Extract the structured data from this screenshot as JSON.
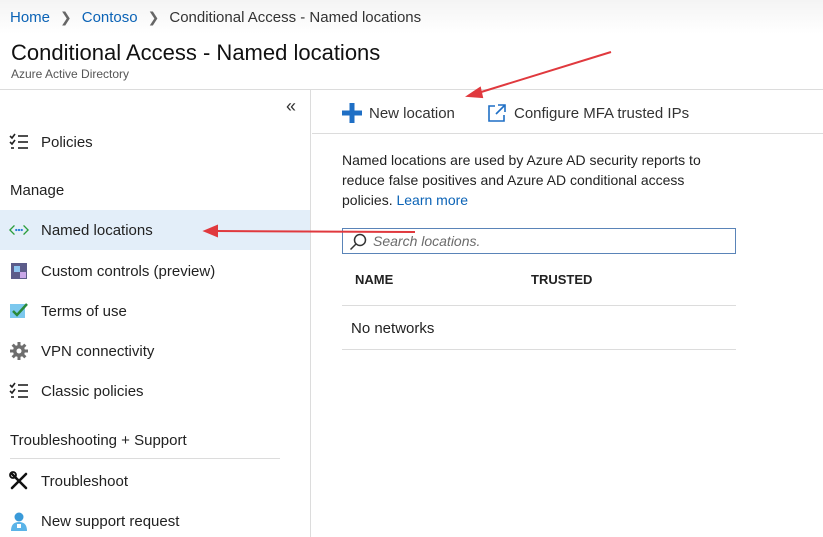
{
  "breadcrumb": {
    "home": "Home",
    "tenant": "Contoso",
    "current": "Conditional Access - Named locations"
  },
  "header": {
    "title": "Conditional Access - Named locations",
    "subtitle": "Azure Active Directory"
  },
  "sidebar": {
    "collapse_glyph": "«",
    "policies": {
      "label": "Policies",
      "icon": "checklist-icon"
    },
    "manage_heading": "Manage",
    "named_locations": {
      "label": "Named locations",
      "icon": "named-locations-icon"
    },
    "custom_controls": {
      "label": "Custom controls (preview)",
      "icon": "custom-controls-icon"
    },
    "terms_of_use": {
      "label": "Terms of use",
      "icon": "terms-check-icon"
    },
    "vpn": {
      "label": "VPN connectivity",
      "icon": "gear-icon"
    },
    "classic_policies": {
      "label": "Classic policies",
      "icon": "checklist-icon"
    },
    "troubleshooting_heading": "Troubleshooting + Support",
    "troubleshoot": {
      "label": "Troubleshoot",
      "icon": "tools-icon"
    },
    "new_support": {
      "label": "New support request",
      "icon": "support-person-icon"
    }
  },
  "toolbar": {
    "new_location": "New location",
    "configure_mfa": "Configure MFA trusted IPs"
  },
  "main": {
    "description": "Named locations are used by Azure AD security reports to reduce false positives and Azure AD conditional access policies.",
    "learn_more": "Learn more",
    "search_placeholder": "Search locations.",
    "columns": [
      "NAME",
      "TRUSTED"
    ],
    "empty_text": "No networks"
  },
  "colors": {
    "link": "#0b63b6",
    "active_bg": "#e3eef9",
    "annotation_arrow": "#e0393e",
    "accent": "#0b63b6"
  }
}
